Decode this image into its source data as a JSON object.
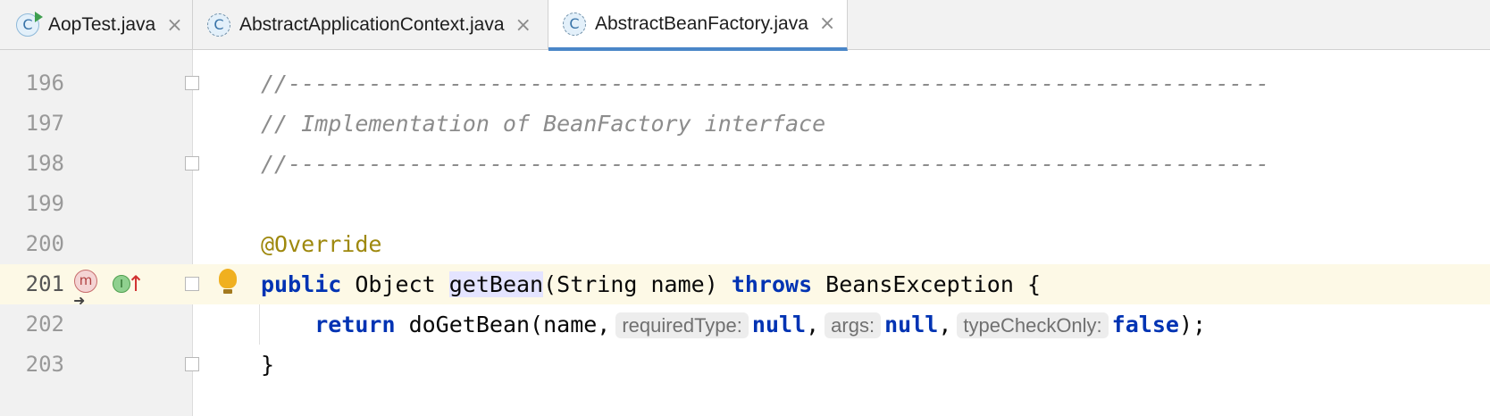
{
  "tabs": [
    {
      "label": "AopTest.java",
      "icon": "class-run-icon",
      "active": false
    },
    {
      "label": "AbstractApplicationContext.java",
      "icon": "class-icon",
      "active": false
    },
    {
      "label": "AbstractBeanFactory.java",
      "icon": "class-icon",
      "active": true
    }
  ],
  "icon_glyphs": {
    "class": "C",
    "close": "×",
    "method": "m",
    "interface": "I",
    "override_arrow": "↑"
  },
  "lines": {
    "n196": "196",
    "n197": "197",
    "n198": "198",
    "n199": "199",
    "n200": "200",
    "n201": "201",
    "n202": "202",
    "n203": "203",
    "l196": "//-------------------------------------------------------------------------",
    "l197": "// Implementation of BeanFactory interface",
    "l198": "//-------------------------------------------------------------------------",
    "l200": "@Override",
    "l201": {
      "kw_public": "public",
      "t1": " Object ",
      "method_name": "getBean",
      "t2": "(String name) ",
      "kw_throws": "throws",
      "t3": " BeansException {"
    },
    "l202": {
      "indent": "    ",
      "kw_return": "return",
      "t1": " doGetBean(name,",
      "hint1": "requiredType:",
      "v1": "null",
      "c1": ",",
      "hint2": "args:",
      "v2": "null",
      "c2": ",",
      "hint3": "typeCheckOnly:",
      "v3": "false",
      "t2": ");"
    },
    "l203": "}"
  },
  "colors": {
    "keyword": "#0033b3",
    "annotation": "#9e880d",
    "comment": "#8c8c8c",
    "current_line": "#fdf9e6",
    "active_tab_underline": "#4a86c8"
  }
}
